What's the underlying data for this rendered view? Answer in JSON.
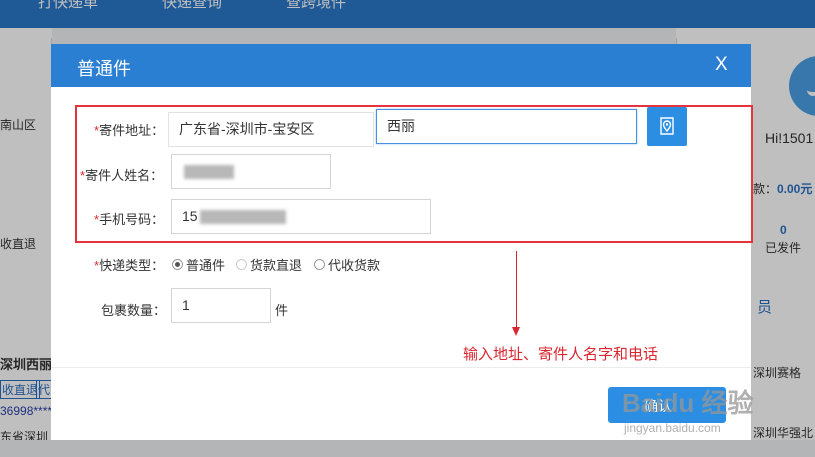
{
  "top_nav": [
    "打快递单",
    "快递查询",
    "查跨境件"
  ],
  "left_fragments": [
    "南山区",
    "收直退",
    "深圳西丽",
    "收直退",
    "代",
    "36998****",
    "东省深圳"
  ],
  "right_panel": {
    "greeting": "Hi!1501",
    "balance_label": "款：",
    "balance_value": "0.00元",
    "shipped_count": "0",
    "shipped_label": "已发件",
    "member_label": "员",
    "item1": "深圳赛格",
    "item2": "深圳华强北"
  },
  "modal": {
    "title": "普通件",
    "close_label": "X",
    "sender_address": {
      "required_mark": "*",
      "label": "寄件地址：",
      "region_value": "广东省-深圳市-宝安区",
      "detail_value": "西丽"
    },
    "sender_name": {
      "required_mark": "*",
      "label": "寄件人姓名：",
      "value": ""
    },
    "phone": {
      "required_mark": "*",
      "label": "手机号码：",
      "value": "15"
    },
    "express_type": {
      "required_mark": "*",
      "label": "快递类型：",
      "options": [
        "普通件",
        "货款直退",
        "代收货款"
      ],
      "selected": "普通件"
    },
    "package_count": {
      "label": "包裹数量：",
      "value": "1",
      "unit": "件"
    },
    "confirm_label": "确认"
  },
  "annotation": "输入地址、寄件人名字和电话",
  "watermark": {
    "main": "Baidu 经验",
    "sub": "jingyan.baidu.com"
  },
  "colors": {
    "header_blue": "#2b7fd3",
    "button_blue": "#2b8ee3",
    "highlight_red": "#e5333e",
    "required_red": "#e02b2b"
  },
  "icons": {
    "location": "location-pin-icon",
    "close": "close-icon"
  }
}
